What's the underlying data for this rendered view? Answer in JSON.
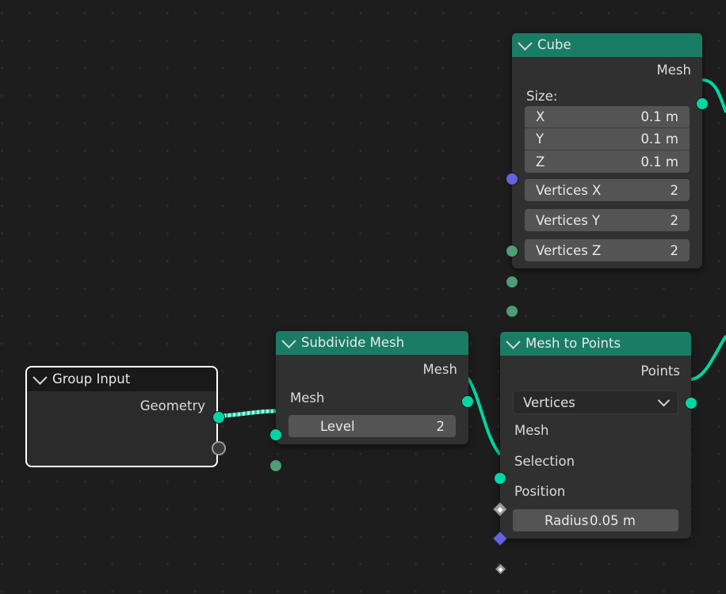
{
  "editor": {
    "name": "Geometry Node Editor",
    "background_color": "#1d1d1d",
    "grid_dot_color": "#2b2b2b",
    "wire_color": "#00d6a3",
    "header_geometry_color": "#1a7c65",
    "header_input_color": "#191919",
    "node_body_color": "#303030",
    "field_color": "#545454",
    "selected_outline_color": "#ffffff"
  },
  "nodes": {
    "cube": {
      "title": "Cube",
      "outputs": [
        {
          "label": "Mesh",
          "socket": "geometry"
        }
      ],
      "size_label": "Size:",
      "size_fields": [
        {
          "name": "X",
          "value": "0.1 m"
        },
        {
          "name": "Y",
          "value": "0.1 m"
        },
        {
          "name": "Z",
          "value": "0.1 m"
        }
      ],
      "vertex_fields": [
        {
          "name": "Vertices X",
          "value": "2"
        },
        {
          "name": "Vertices Y",
          "value": "2"
        },
        {
          "name": "Vertices Z",
          "value": "2"
        }
      ]
    },
    "group_input": {
      "title": "Group Input",
      "outputs": [
        {
          "label": "Geometry",
          "socket": "geometry"
        },
        {
          "label": "",
          "socket": "empty"
        }
      ]
    },
    "subdivide_mesh": {
      "title": "Subdivide Mesh",
      "outputs": [
        {
          "label": "Mesh",
          "socket": "geometry"
        }
      ],
      "inputs": [
        {
          "label": "Mesh",
          "socket": "geometry"
        }
      ],
      "level_field": {
        "name": "Level",
        "value": "2"
      }
    },
    "mesh_to_points": {
      "title": "Mesh to Points",
      "outputs": [
        {
          "label": "Points",
          "socket": "geometry"
        }
      ],
      "mode_dropdown": {
        "selected": "Vertices",
        "icon": "chevron-down-icon"
      },
      "inputs": [
        {
          "label": "Mesh",
          "socket": "geometry"
        },
        {
          "label": "Selection",
          "socket": "field-boolean"
        },
        {
          "label": "Position",
          "socket": "vector"
        }
      ],
      "radius_field": {
        "name": "Radius",
        "value": "0.05 m"
      }
    }
  },
  "links": [
    {
      "from": "group_input.Geometry",
      "to": "subdivide_mesh.Mesh",
      "style": "dashed"
    },
    {
      "from": "subdivide_mesh.Mesh",
      "to": "mesh_to_points.Mesh",
      "style": "solid"
    },
    {
      "from": "cube.Mesh",
      "to": "offscreen-right",
      "style": "solid"
    },
    {
      "from": "mesh_to_points.Points",
      "to": "offscreen-right",
      "style": "solid"
    }
  ]
}
